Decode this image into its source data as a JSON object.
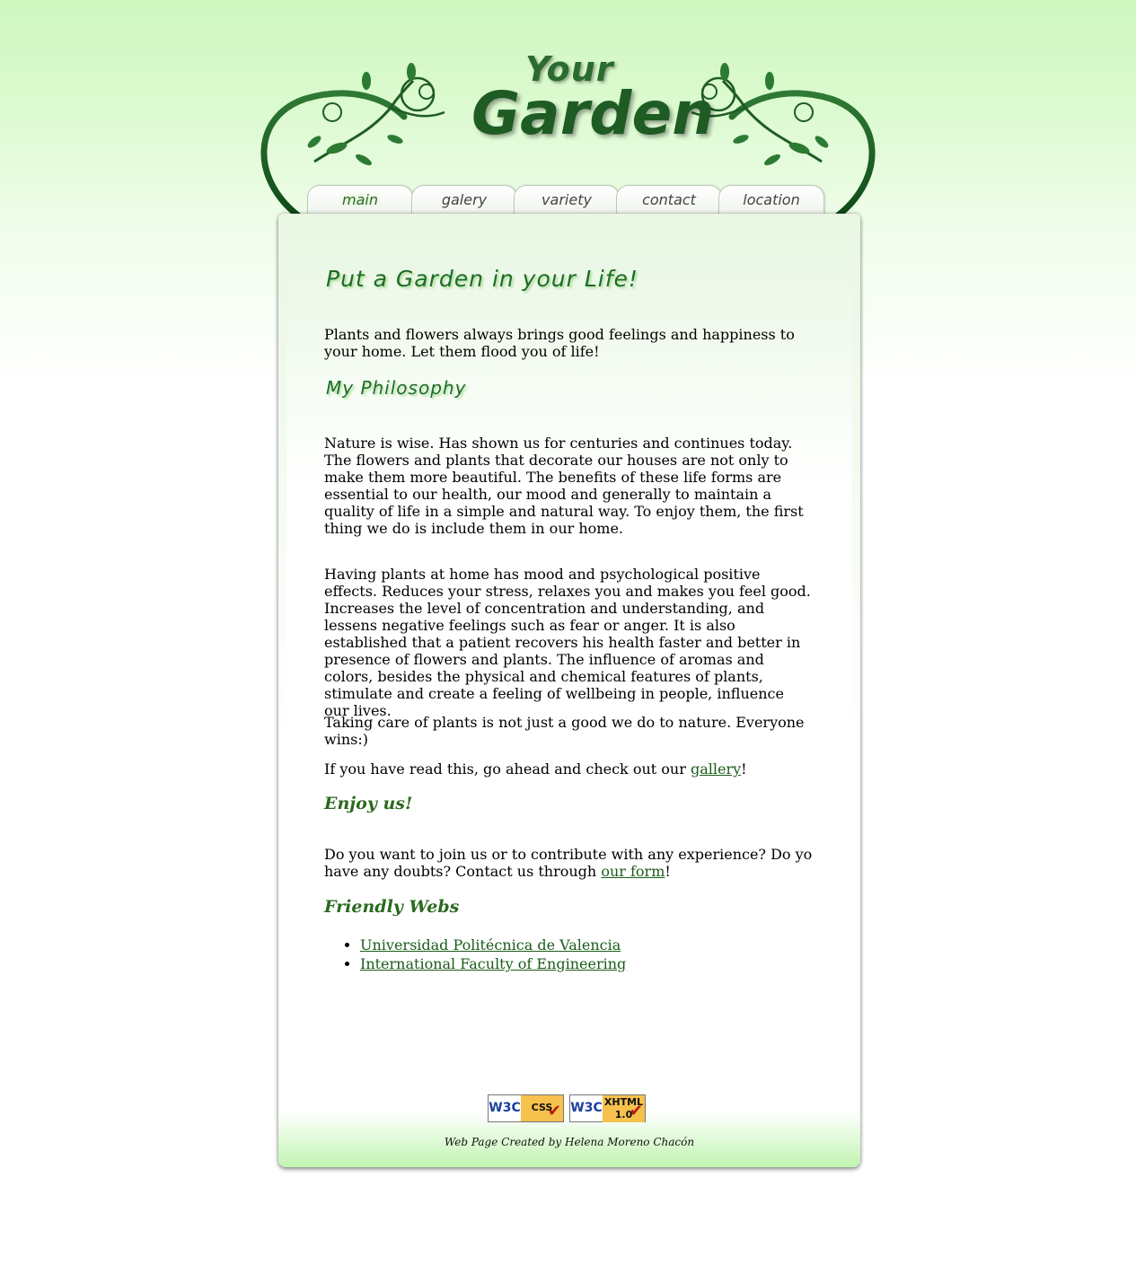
{
  "header": {
    "logo_line1": "Your",
    "logo_line2": "Garden"
  },
  "nav": {
    "tabs": [
      {
        "label": "main",
        "active": true
      },
      {
        "label": "galery",
        "active": false
      },
      {
        "label": "variety",
        "active": false
      },
      {
        "label": "contact",
        "active": false
      },
      {
        "label": "location",
        "active": false
      }
    ]
  },
  "main": {
    "title": "Put a Garden in your Life!",
    "intro": "Plants and flowers always brings good feelings and happiness to your home. Let them flood you of life!",
    "philosophy_heading": "My Philosophy",
    "paragraph1": "Nature is wise. Has shown us for centuries and continues today. The flowers and plants that decorate our houses are not only to make them more beautiful. The benefits of these life forms are essential to our health, our mood and generally to maintain a quality of life in a simple and natural way. To enjoy them, the first thing we do is include them in our home.",
    "paragraph2": "Having plants at home has mood and psychological positive effects. Reduces your stress, relaxes you and makes you feel good. Increases the level of concentration and understanding, and lessens negative feelings such as fear or anger. It is also established that a patient recovers his health faster and better in presence of flowers and plants. The influence of aromas and colors, besides the physical and chemical features of plants, stimulate and create a feeling of wellbeing in people, influence our lives.",
    "paragraph3": "Taking care of plants is not just a good we do to nature. Everyone wins:)",
    "gallery_prefix": "If you have read this, go ahead and check out our ",
    "gallery_link": "gallery",
    "gallery_suffix": "!",
    "enjoy_heading": "Enjoy us!",
    "contact_prefix": "Do you want to join us or to contribute with any experience? Do yo have any doubts? Contact us through ",
    "contact_link": "our form",
    "contact_suffix": "!",
    "friendly_heading": "Friendly Webs",
    "friendly_links": [
      "Universidad Politécnica de Valencia",
      "International Faculty of Engineering"
    ]
  },
  "footer": {
    "badge_css_logo": "W3C",
    "badge_css_label": "CSS",
    "badge_xhtml_logo": "W3C",
    "badge_xhtml_label": "XHTML 1.0",
    "credit": "Web Page Created by Helena Moreno Chacón"
  },
  "colors": {
    "accent_green": "#1e6c28",
    "heading_green": "#2b6a1f",
    "link_green": "#1a5c1a"
  }
}
